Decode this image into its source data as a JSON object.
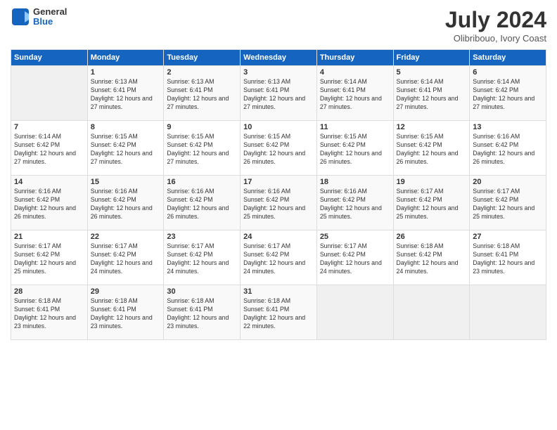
{
  "header": {
    "logo": {
      "general": "General",
      "blue": "Blue"
    },
    "title": "July 2024",
    "subtitle": "Olibribouo, Ivory Coast"
  },
  "weekdays": [
    "Sunday",
    "Monday",
    "Tuesday",
    "Wednesday",
    "Thursday",
    "Friday",
    "Saturday"
  ],
  "weeks": [
    [
      {
        "day": "",
        "sunrise": "",
        "sunset": "",
        "daylight": ""
      },
      {
        "day": "1",
        "sunrise": "Sunrise: 6:13 AM",
        "sunset": "Sunset: 6:41 PM",
        "daylight": "Daylight: 12 hours and 27 minutes."
      },
      {
        "day": "2",
        "sunrise": "Sunrise: 6:13 AM",
        "sunset": "Sunset: 6:41 PM",
        "daylight": "Daylight: 12 hours and 27 minutes."
      },
      {
        "day": "3",
        "sunrise": "Sunrise: 6:13 AM",
        "sunset": "Sunset: 6:41 PM",
        "daylight": "Daylight: 12 hours and 27 minutes."
      },
      {
        "day": "4",
        "sunrise": "Sunrise: 6:14 AM",
        "sunset": "Sunset: 6:41 PM",
        "daylight": "Daylight: 12 hours and 27 minutes."
      },
      {
        "day": "5",
        "sunrise": "Sunrise: 6:14 AM",
        "sunset": "Sunset: 6:41 PM",
        "daylight": "Daylight: 12 hours and 27 minutes."
      },
      {
        "day": "6",
        "sunrise": "Sunrise: 6:14 AM",
        "sunset": "Sunset: 6:42 PM",
        "daylight": "Daylight: 12 hours and 27 minutes."
      }
    ],
    [
      {
        "day": "7",
        "sunrise": "Sunrise: 6:14 AM",
        "sunset": "Sunset: 6:42 PM",
        "daylight": "Daylight: 12 hours and 27 minutes."
      },
      {
        "day": "8",
        "sunrise": "Sunrise: 6:15 AM",
        "sunset": "Sunset: 6:42 PM",
        "daylight": "Daylight: 12 hours and 27 minutes."
      },
      {
        "day": "9",
        "sunrise": "Sunrise: 6:15 AM",
        "sunset": "Sunset: 6:42 PM",
        "daylight": "Daylight: 12 hours and 27 minutes."
      },
      {
        "day": "10",
        "sunrise": "Sunrise: 6:15 AM",
        "sunset": "Sunset: 6:42 PM",
        "daylight": "Daylight: 12 hours and 26 minutes."
      },
      {
        "day": "11",
        "sunrise": "Sunrise: 6:15 AM",
        "sunset": "Sunset: 6:42 PM",
        "daylight": "Daylight: 12 hours and 26 minutes."
      },
      {
        "day": "12",
        "sunrise": "Sunrise: 6:15 AM",
        "sunset": "Sunset: 6:42 PM",
        "daylight": "Daylight: 12 hours and 26 minutes."
      },
      {
        "day": "13",
        "sunrise": "Sunrise: 6:16 AM",
        "sunset": "Sunset: 6:42 PM",
        "daylight": "Daylight: 12 hours and 26 minutes."
      }
    ],
    [
      {
        "day": "14",
        "sunrise": "Sunrise: 6:16 AM",
        "sunset": "Sunset: 6:42 PM",
        "daylight": "Daylight: 12 hours and 26 minutes."
      },
      {
        "day": "15",
        "sunrise": "Sunrise: 6:16 AM",
        "sunset": "Sunset: 6:42 PM",
        "daylight": "Daylight: 12 hours and 26 minutes."
      },
      {
        "day": "16",
        "sunrise": "Sunrise: 6:16 AM",
        "sunset": "Sunset: 6:42 PM",
        "daylight": "Daylight: 12 hours and 26 minutes."
      },
      {
        "day": "17",
        "sunrise": "Sunrise: 6:16 AM",
        "sunset": "Sunset: 6:42 PM",
        "daylight": "Daylight: 12 hours and 25 minutes."
      },
      {
        "day": "18",
        "sunrise": "Sunrise: 6:16 AM",
        "sunset": "Sunset: 6:42 PM",
        "daylight": "Daylight: 12 hours and 25 minutes."
      },
      {
        "day": "19",
        "sunrise": "Sunrise: 6:17 AM",
        "sunset": "Sunset: 6:42 PM",
        "daylight": "Daylight: 12 hours and 25 minutes."
      },
      {
        "day": "20",
        "sunrise": "Sunrise: 6:17 AM",
        "sunset": "Sunset: 6:42 PM",
        "daylight": "Daylight: 12 hours and 25 minutes."
      }
    ],
    [
      {
        "day": "21",
        "sunrise": "Sunrise: 6:17 AM",
        "sunset": "Sunset: 6:42 PM",
        "daylight": "Daylight: 12 hours and 25 minutes."
      },
      {
        "day": "22",
        "sunrise": "Sunrise: 6:17 AM",
        "sunset": "Sunset: 6:42 PM",
        "daylight": "Daylight: 12 hours and 24 minutes."
      },
      {
        "day": "23",
        "sunrise": "Sunrise: 6:17 AM",
        "sunset": "Sunset: 6:42 PM",
        "daylight": "Daylight: 12 hours and 24 minutes."
      },
      {
        "day": "24",
        "sunrise": "Sunrise: 6:17 AM",
        "sunset": "Sunset: 6:42 PM",
        "daylight": "Daylight: 12 hours and 24 minutes."
      },
      {
        "day": "25",
        "sunrise": "Sunrise: 6:17 AM",
        "sunset": "Sunset: 6:42 PM",
        "daylight": "Daylight: 12 hours and 24 minutes."
      },
      {
        "day": "26",
        "sunrise": "Sunrise: 6:18 AM",
        "sunset": "Sunset: 6:42 PM",
        "daylight": "Daylight: 12 hours and 24 minutes."
      },
      {
        "day": "27",
        "sunrise": "Sunrise: 6:18 AM",
        "sunset": "Sunset: 6:41 PM",
        "daylight": "Daylight: 12 hours and 23 minutes."
      }
    ],
    [
      {
        "day": "28",
        "sunrise": "Sunrise: 6:18 AM",
        "sunset": "Sunset: 6:41 PM",
        "daylight": "Daylight: 12 hours and 23 minutes."
      },
      {
        "day": "29",
        "sunrise": "Sunrise: 6:18 AM",
        "sunset": "Sunset: 6:41 PM",
        "daylight": "Daylight: 12 hours and 23 minutes."
      },
      {
        "day": "30",
        "sunrise": "Sunrise: 6:18 AM",
        "sunset": "Sunset: 6:41 PM",
        "daylight": "Daylight: 12 hours and 23 minutes."
      },
      {
        "day": "31",
        "sunrise": "Sunrise: 6:18 AM",
        "sunset": "Sunset: 6:41 PM",
        "daylight": "Daylight: 12 hours and 22 minutes."
      },
      {
        "day": "",
        "sunrise": "",
        "sunset": "",
        "daylight": ""
      },
      {
        "day": "",
        "sunrise": "",
        "sunset": "",
        "daylight": ""
      },
      {
        "day": "",
        "sunrise": "",
        "sunset": "",
        "daylight": ""
      }
    ]
  ]
}
